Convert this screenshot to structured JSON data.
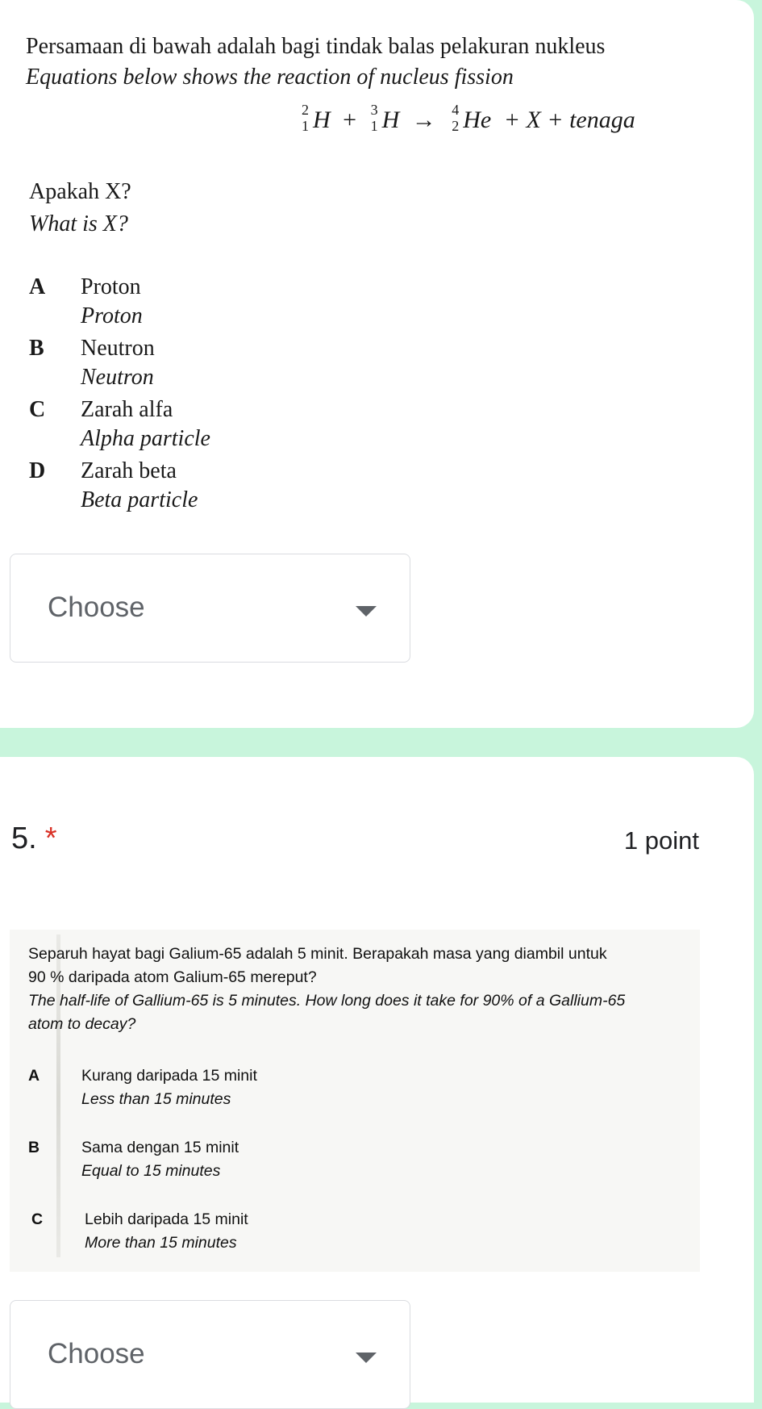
{
  "question4": {
    "line1": "Persamaan di bawah adalah bagi tindak balas pelakuran nukleus",
    "line2": "Equations below shows the reaction of nucleus fission",
    "equation": {
      "t1": {
        "mass": "2",
        "atomic": "1",
        "symbol": "H"
      },
      "op1": "+",
      "t2": {
        "mass": "3",
        "atomic": "1",
        "symbol": "H"
      },
      "arrow": "→",
      "t3": {
        "mass": "4",
        "atomic": "2",
        "symbol": "He"
      },
      "rest": "+ X + tenaga"
    },
    "ask_ms": "Apakah X?",
    "ask_en": "What is X?",
    "options": [
      {
        "letter": "A",
        "ms": "Proton",
        "en": "Proton"
      },
      {
        "letter": "B",
        "ms": "Neutron",
        "en": "Neutron"
      },
      {
        "letter": "C",
        "ms": "Zarah alfa",
        "en": "Alpha particle"
      },
      {
        "letter": "D",
        "ms": "Zarah beta",
        "en": "Beta particle"
      }
    ],
    "dropdown": {
      "label": "Choose"
    }
  },
  "question5": {
    "number": "5.",
    "required_mark": "*",
    "points": "1 point",
    "text_ms_1": "Separuh hayat bagi Galium-65 adalah 5 minit. Berapakah masa yang diambil untuk",
    "text_ms_2": "90 % daripada atom Galium-65 mereput?",
    "text_en_1": "The half-life of Gallium-65 is 5 minutes. How long does it take for 90% of a Gallium-65",
    "text_en_2": "atom to decay?",
    "options": [
      {
        "letter": "A",
        "ms": "Kurang daripada 15 minit",
        "en": "Less than 15 minutes"
      },
      {
        "letter": "B",
        "ms": "Sama dengan 15 minit",
        "en": "Equal to 15 minutes"
      },
      {
        "letter": "C",
        "ms": "Lebih daripada 15 minit",
        "en": "More than 15 minutes"
      }
    ],
    "dropdown": {
      "label": "Choose"
    }
  }
}
